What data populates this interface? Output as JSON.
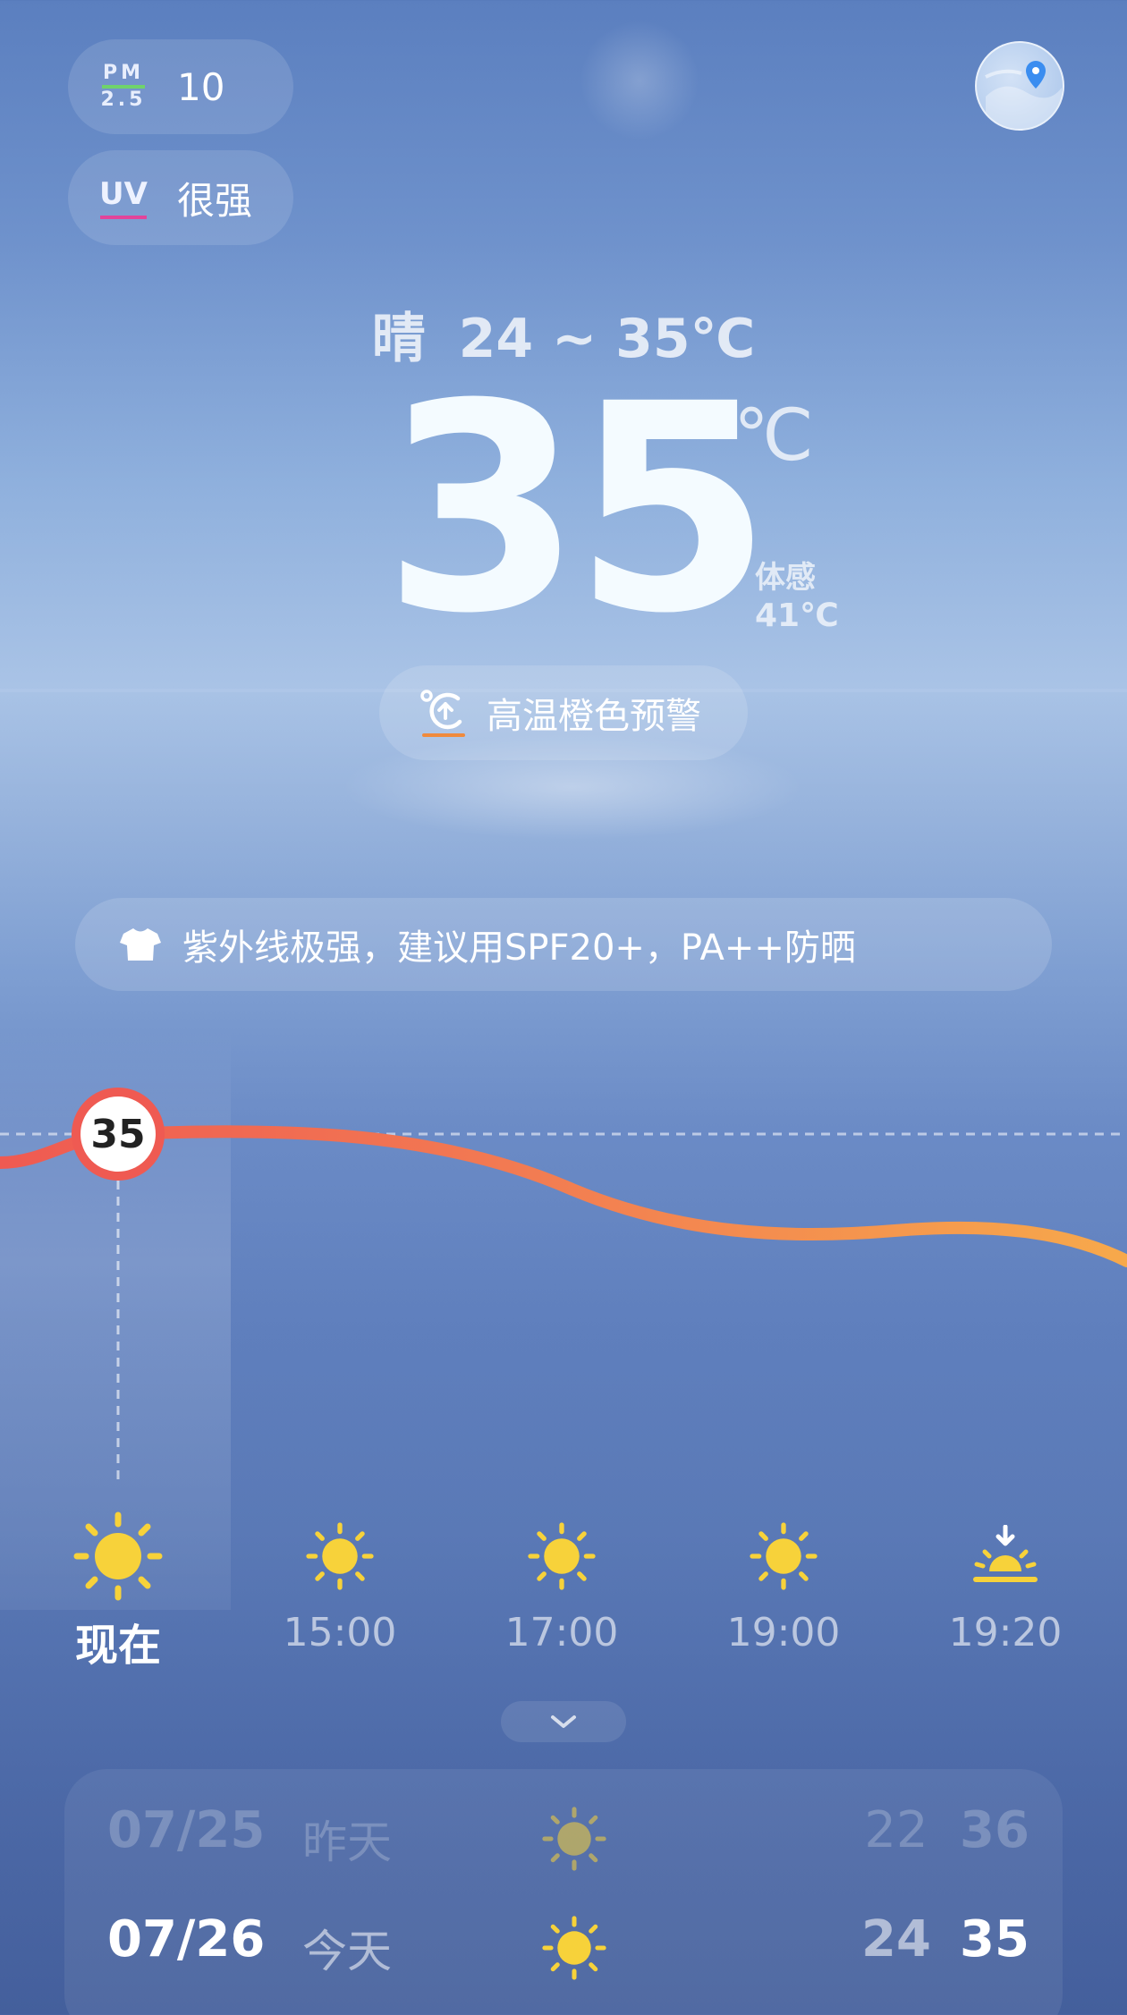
{
  "air": {
    "pm_label_top": "PM",
    "pm_label_bottom": "2.5",
    "pm_value": "10",
    "uv_label": "UV",
    "uv_value": "很强"
  },
  "location": {
    "icon": "location-pin-icon"
  },
  "current": {
    "condition": "晴",
    "range": "24 ~ 35℃",
    "temp": "35",
    "unit": "℃",
    "feels_label": "体感",
    "feels_value": "41℃"
  },
  "warning": {
    "icon": "high-temperature-icon",
    "text": "高温橙色预警",
    "accent": "#f08a3c"
  },
  "advice": {
    "icon": "tshirt-icon",
    "text": "紫外线极强，建议用SPF20+，PA++防晒"
  },
  "hourly": {
    "now_temp": "35",
    "curve_color_start": "#ef5a52",
    "curve_color_end": "#f7a94b",
    "items": [
      {
        "time": "现在",
        "icon": "sun-icon"
      },
      {
        "time": "15:00",
        "icon": "sun-icon"
      },
      {
        "time": "17:00",
        "icon": "sun-icon"
      },
      {
        "time": "19:00",
        "icon": "sun-icon"
      },
      {
        "time": "19:20",
        "icon": "sunset-icon"
      }
    ]
  },
  "daily": [
    {
      "date": "07/25",
      "name": "昨天",
      "icon": "sun-icon",
      "low": "22",
      "high": "36"
    },
    {
      "date": "07/26",
      "name": "今天",
      "icon": "sun-icon",
      "low": "24",
      "high": "35"
    }
  ],
  "colors": {
    "sun": "#f7d23a",
    "pm_bar": "#6fd36b",
    "uv_bar": "#e2449a"
  }
}
